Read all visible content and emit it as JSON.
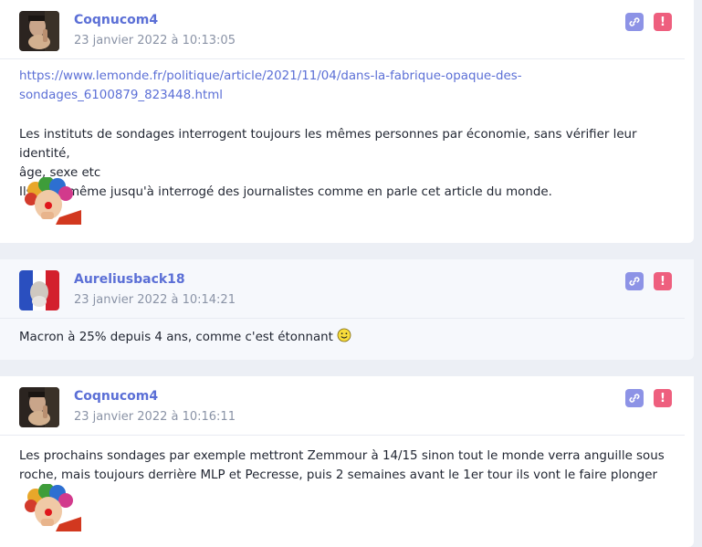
{
  "posts": [
    {
      "username": "Coqnucom4",
      "timestamp": "23 janvier 2022 à 10:13:05",
      "link_line1": "https://www.lemonde.fr/politique/article/2021/11/04/dans-la-fabrique-opaque-des-",
      "link_line2": "sondages_6100879_823448.html",
      "text_line1": "Les instituts de sondages interrogent toujours les mêmes personnes par économie, sans vérifier leur identité,",
      "text_line2": "âge, sexe etc",
      "text_line3": "Ils vont même jusqu'à interrogé des journalistes comme en parle cet article du monde."
    },
    {
      "username": "Aureliusback18",
      "timestamp": "23 janvier 2022 à 10:14:21",
      "text_line1": "Macron à 25% depuis 4 ans, comme c'est étonnant"
    },
    {
      "username": "Coqnucom4",
      "timestamp": "23 janvier 2022 à 10:16:11",
      "text_line1": "Les prochains sondages par exemple mettront Zemmour à 14/15 sinon tout le monde verra anguille sous",
      "text_line2": "roche, mais toujours derrière MLP et Pecresse, puis 2 semaines avant le 1er tour ils vont le faire plonger"
    }
  ],
  "colors": {
    "accent": "#5b6fd6",
    "link_button": "#8d93e6",
    "report_button": "#ee5f7e",
    "background": "#eceff5"
  },
  "icons": [
    "chain-link-icon",
    "exclamation-icon",
    "clown-sticker",
    "smiley-emoji"
  ]
}
